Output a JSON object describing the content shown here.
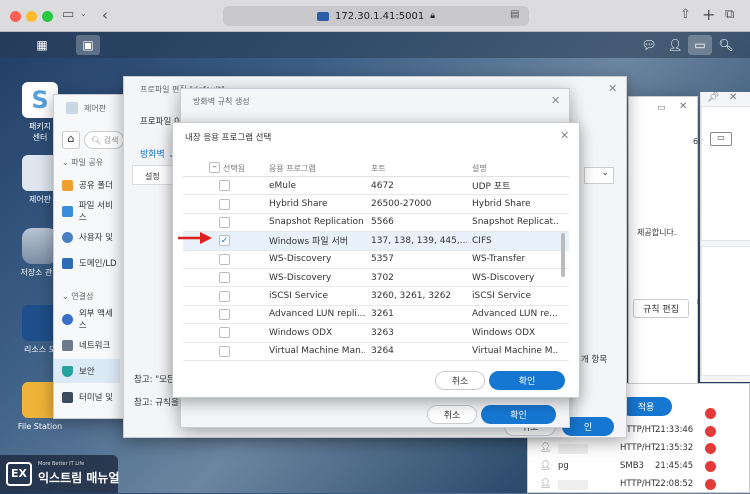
{
  "browser": {
    "url": "172.30.1.41:5001"
  },
  "desktop": {
    "icons": [
      {
        "label": "패키지\n센터"
      },
      {
        "label": "제어판"
      },
      {
        "label": "저장소 관리"
      },
      {
        "label": "리소스 모"
      },
      {
        "label": "File Station"
      }
    ]
  },
  "control_panel": {
    "title": "제어판",
    "search_placeholder": "검색",
    "section1": "파일 공유",
    "items1": [
      "공유 폴더",
      "파일 서비스",
      "사용자 및",
      "도메인/LD"
    ],
    "section2": "연결성",
    "items2": [
      "외부 액세스",
      "네트워크",
      "보안",
      "터미널 및"
    ]
  },
  "profile_window": {
    "title": "프로파일 편집 \"default\"",
    "profile_label": "프로파일 이",
    "tab": "방화벽",
    "col_status": "설정",
    "note1": "참고: \"모든",
    "note2": "참고: 규칙을"
  },
  "rule_window": {
    "title": "방화벽 규칙 생성",
    "right_label": "개 항목",
    "cancel": "취소",
    "ok": "확인"
  },
  "dialog": {
    "title": "내장 응용 프로그램 선택",
    "headers": {
      "select": "선택됨",
      "app": "응용 프로그램",
      "port": "포트",
      "desc": "설명"
    },
    "rows": [
      {
        "app": "eMule",
        "port": "4672",
        "desc": "UDP 포트",
        "checked": false
      },
      {
        "app": "Hybrid Share",
        "port": "26500-27000",
        "desc": "Hybrid Share",
        "checked": false
      },
      {
        "app": "Snapshot Replication",
        "port": "5566",
        "desc": "Snapshot Replicat...",
        "checked": false
      },
      {
        "app": "Windows 파일 서버",
        "port": "137, 138, 139, 445,...",
        "desc": "CIFS",
        "checked": true
      },
      {
        "app": "WS-Discovery",
        "port": "5357",
        "desc": "WS-Transfer",
        "checked": false
      },
      {
        "app": "WS-Discovery",
        "port": "3702",
        "desc": "WS-Discovery",
        "checked": false
      },
      {
        "app": "iSCSI Service",
        "port": "3260, 3261, 3262",
        "desc": "iSCSI Service",
        "checked": false
      },
      {
        "app": "Advanced LUN repli...",
        "port": "3261",
        "desc": "Advanced LUN re...",
        "checked": false
      },
      {
        "app": "Windows ODX",
        "port": "3263",
        "desc": "Windows ODX",
        "checked": false
      },
      {
        "app": "Virtual Machine Man...",
        "port": "3264",
        "desc": "Virtual Machine M...",
        "checked": false
      }
    ],
    "cancel": "취소",
    "ok": "확인"
  },
  "right_panel": {
    "time_top": "6:00",
    "text1": "제공합니다.",
    "rule_edit": "규칙 편집",
    "text2": "다.",
    "apply": "적용",
    "log": [
      {
        "user": "",
        "proto": "HTTP/HT...",
        "time": "21:35:32"
      },
      {
        "user": "pg",
        "proto": "SMB3",
        "time": "21:45:45"
      },
      {
        "user": "",
        "proto": "HTTP/HT...",
        "time": "22:08:52"
      }
    ],
    "ok_partial": "인",
    "proto_partial": "HTTP/HT...",
    "time_partial": "21:33:46"
  },
  "watermark": {
    "logo": "EX",
    "small": "More Better IT Life",
    "brand": "익스트림 매뉴얼"
  },
  "colors": {
    "accent": "#1677d2",
    "arrow": "#e0201c"
  }
}
